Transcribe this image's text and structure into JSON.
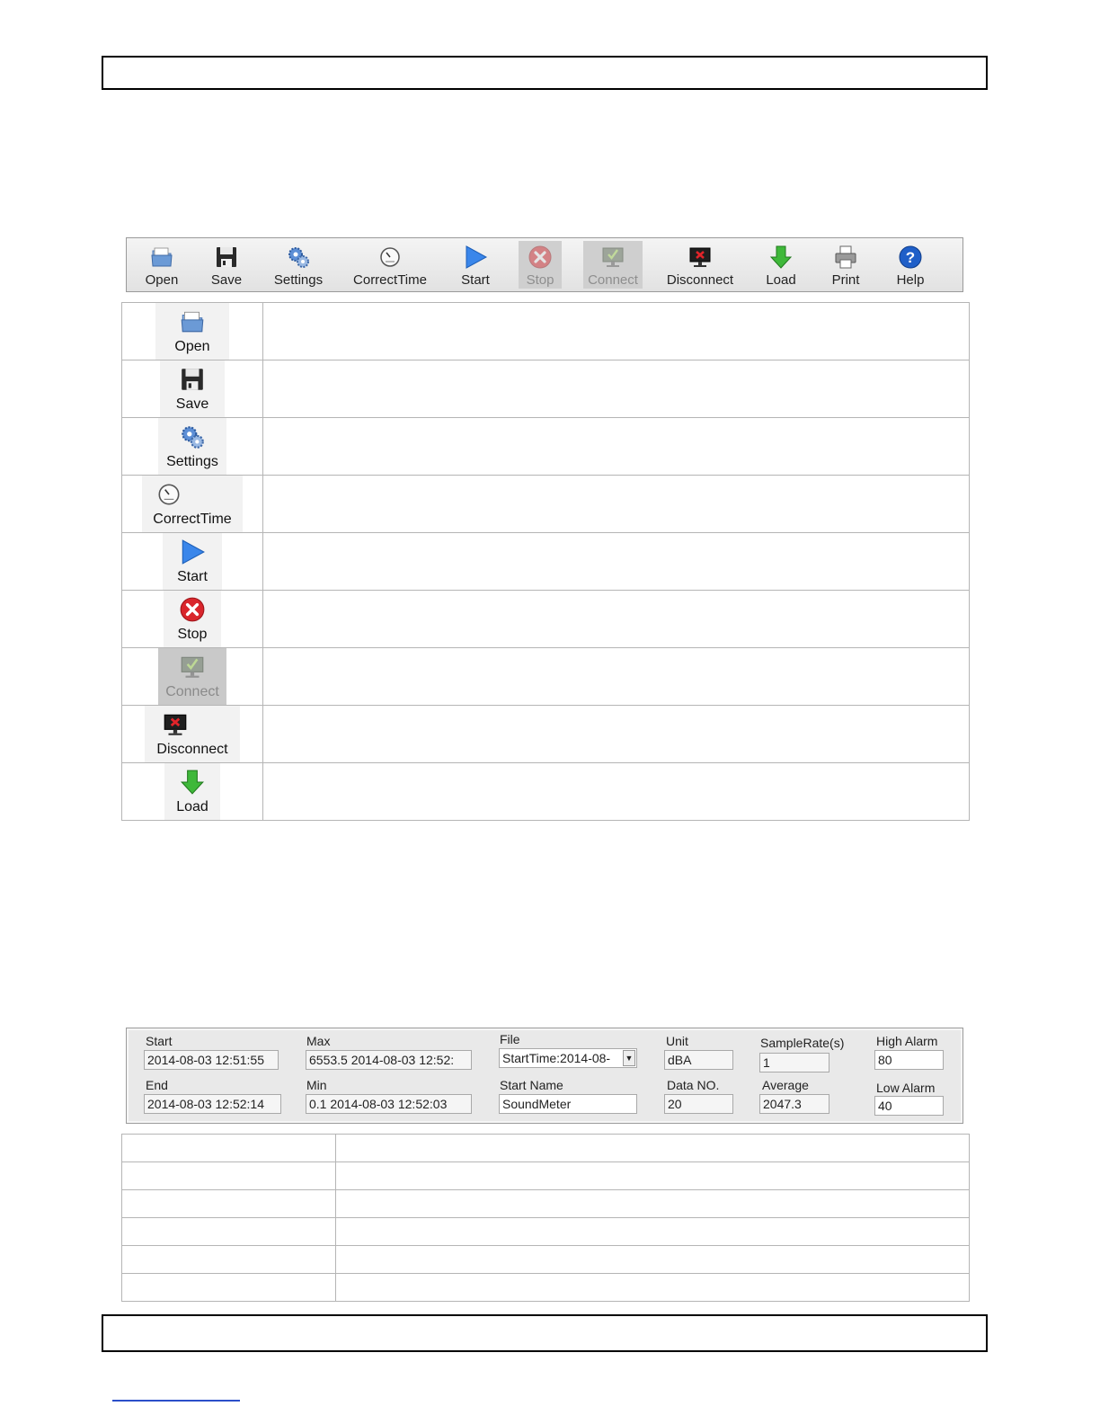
{
  "toolbar": {
    "buttons": [
      {
        "label": "Open",
        "icon": "folder-icon"
      },
      {
        "label": "Save",
        "icon": "floppy-disk-icon"
      },
      {
        "label": "Settings",
        "icon": "gears-icon"
      },
      {
        "label": "CorrectTime",
        "icon": "clock-icon"
      },
      {
        "label": "Start",
        "icon": "play-icon"
      },
      {
        "label": "Stop",
        "icon": "stop-icon"
      },
      {
        "label": "Connect",
        "icon": "monitor-check-icon"
      },
      {
        "label": "Disconnect",
        "icon": "monitor-x-icon"
      },
      {
        "label": "Load",
        "icon": "download-arrow-icon"
      },
      {
        "label": "Print",
        "icon": "printer-icon"
      },
      {
        "label": "Help",
        "icon": "help-icon"
      }
    ]
  },
  "icon_table": {
    "rows": [
      {
        "label": "Open",
        "description": ""
      },
      {
        "label": "Save",
        "description": ""
      },
      {
        "label": "Settings",
        "description": ""
      },
      {
        "label": "CorrectTime",
        "description": ""
      },
      {
        "label": "Start",
        "description": ""
      },
      {
        "label": "Stop",
        "description": ""
      },
      {
        "label": "Connect",
        "description": ""
      },
      {
        "label": "Disconnect",
        "description": ""
      },
      {
        "label": "Load",
        "description": ""
      }
    ]
  },
  "info_panel": {
    "start_label": "Start",
    "start_value": "2014-08-03 12:51:55",
    "end_label": "End",
    "end_value": "2014-08-03  12:52:14",
    "max_label": "Max",
    "max_value": "6553.5 2014-08-03  12:52:",
    "min_label": "Min",
    "min_value": "0.1 2014-08-03  12:52:03",
    "file_label": "File",
    "file_value": "StartTime:2014-08-",
    "start_name_label": "Start Name",
    "start_name_value": "SoundMeter",
    "unit_label": "Unit",
    "unit_value": "dBA",
    "data_no_label": "Data NO.",
    "data_no_value": "20",
    "sample_rate_label": "SampleRate(s)",
    "sample_rate_value": "1",
    "average_label": "Average",
    "average_value": "2047.3",
    "high_alarm_label": "High Alarm",
    "high_alarm_value": "80",
    "low_alarm_label": "Low Alarm",
    "low_alarm_value": "40"
  },
  "colors": {
    "accent_blue": "#2f7be0",
    "stop_red": "#d9262c",
    "load_green": "#3fb83a"
  }
}
